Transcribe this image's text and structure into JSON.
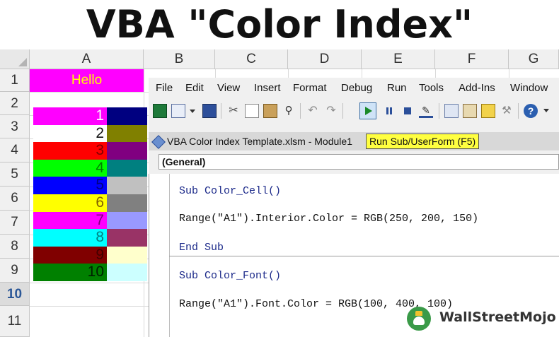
{
  "title": "VBA \"Color Index\"",
  "spreadsheet": {
    "columns": [
      "A",
      "B",
      "C",
      "D",
      "E",
      "F",
      "G"
    ],
    "rows": [
      "1",
      "2",
      "3",
      "4",
      "5",
      "6",
      "7",
      "8",
      "9",
      "10",
      "11"
    ],
    "selected_row": "10",
    "a1_text": "Hello",
    "swatches": [
      {
        "num": "1",
        "bg": "#ff00ff",
        "fg": "#ffffff",
        "right": "#000080"
      },
      {
        "num": "2",
        "bg": "#ffffff",
        "fg": "#111111",
        "right": "#808000"
      },
      {
        "num": "3",
        "bg": "#ff0000",
        "fg": "#800000",
        "right": "#800080"
      },
      {
        "num": "4",
        "bg": "#00ff00",
        "fg": "#008000",
        "right": "#008080"
      },
      {
        "num": "5",
        "bg": "#0000ff",
        "fg": "#000080",
        "right": "#c0c0c0"
      },
      {
        "num": "6",
        "bg": "#ffff00",
        "fg": "#806000",
        "right": "#808080"
      },
      {
        "num": "7",
        "bg": "#ff00ff",
        "fg": "#800080",
        "right": "#9999ff"
      },
      {
        "num": "8",
        "bg": "#00ffff",
        "fg": "#008080",
        "right": "#993366"
      },
      {
        "num": "9",
        "bg": "#800000",
        "fg": "#400000",
        "right": "#ffffcc"
      },
      {
        "num": "10",
        "bg": "#008000",
        "fg": "#002000",
        "right": "#ccffff"
      }
    ]
  },
  "vbe": {
    "menus": [
      "File",
      "Edit",
      "View",
      "Insert",
      "Format",
      "Debug",
      "Run",
      "Tools",
      "Add-Ins",
      "Window"
    ],
    "title": "VBA Color Index Template.xlsm - Module1",
    "tooltip": "Run Sub/UserForm (F5)",
    "proc_combo": "(General)",
    "code": {
      "line1": "Sub Color_Cell()",
      "line2": "Range(\"A1\").Interior.Color = RGB(250, 200, 150)",
      "line3": "End Sub",
      "line4": "Sub Color_Font()",
      "line5": "Range(\"A1\").Font.Color = RGB(100, 400, 100)"
    }
  },
  "logo": {
    "text": "WallStreetMojo",
    "color": "#3a9a48"
  }
}
